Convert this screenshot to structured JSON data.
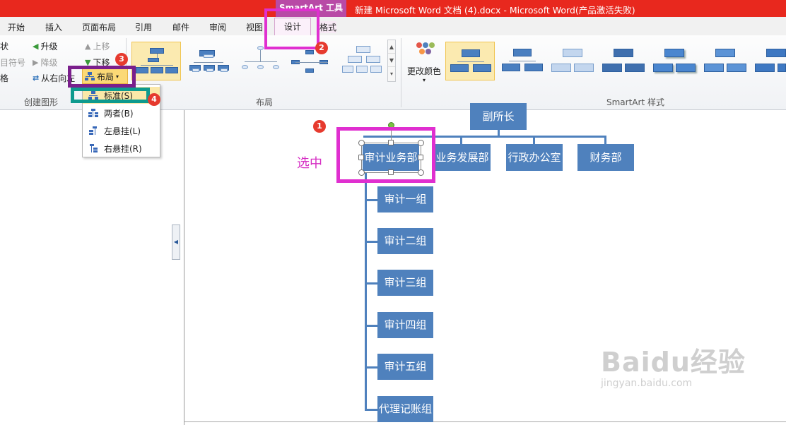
{
  "title_bar": {
    "context_tool": "SmartArt 工具",
    "document_title": "新建 Microsoft Word 文档 (4).docx  -  Microsoft Word(产品激活失败)"
  },
  "tabs": [
    "开始",
    "插入",
    "页面布局",
    "引用",
    "邮件",
    "审阅",
    "视图",
    "设计",
    "格式"
  ],
  "ribbon": {
    "create_graphic": {
      "label": "创建图形",
      "add_shape_partial": "状",
      "add_bullet_partial": "目符号",
      "text_pane_partial": "格",
      "promote": "升级",
      "demote": "降级",
      "right_to_left": "从右向左",
      "move_up": "上移",
      "move_down": "下移",
      "layout_button": "布局"
    },
    "layouts_label": "布局",
    "change_colors": "更改颜色",
    "styles_label": "SmartArt 样式"
  },
  "layout_menu": {
    "items": [
      {
        "label": "标准(S)",
        "text": "标准",
        "key": "S"
      },
      {
        "label": "两者(B)",
        "text": "两者",
        "key": "B"
      },
      {
        "label": "左悬挂(L)",
        "text": "左悬挂",
        "key": "L"
      },
      {
        "label": "右悬挂(R)",
        "text": "右悬挂",
        "key": "R"
      }
    ]
  },
  "org_chart": {
    "top": "副所长",
    "departments": [
      "审计业务部",
      "业务发展部",
      "行政办公室",
      "财务部"
    ],
    "selected": "审计业务部",
    "subgroups": [
      "审计一组",
      "审计二组",
      "审计三组",
      "审计四组",
      "审计五组",
      "代理记账组"
    ]
  },
  "annotations": {
    "select_label": "选中",
    "badges": [
      "1",
      "2",
      "3",
      "4"
    ],
    "colors": {
      "magenta": "#e02fd0",
      "purple": "#7a1f8c",
      "teal": "#0e9a8e",
      "badge_red": "#e63a2e"
    }
  },
  "watermark": {
    "brand": "Baidu经验",
    "url": "jingyan.baidu.com"
  }
}
